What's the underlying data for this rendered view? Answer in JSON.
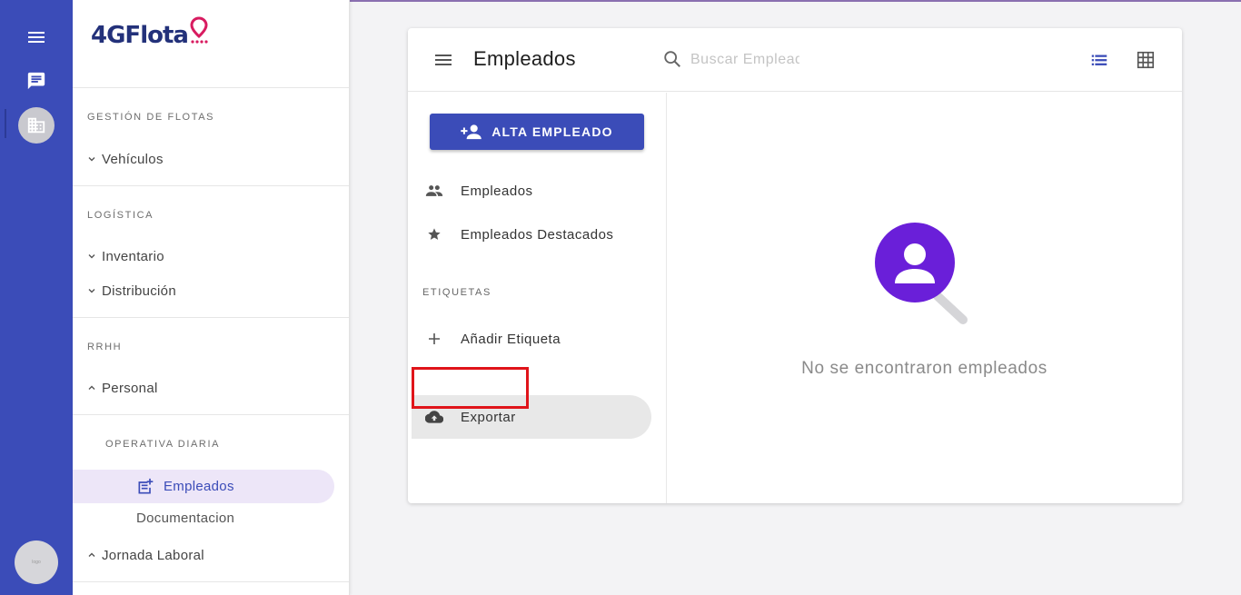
{
  "app": {
    "logo": "4GFlota"
  },
  "rail": {
    "menu_icon": "hamburger-icon",
    "chat_icon": "chat-icon",
    "company_icon": "building-icon",
    "avatar_text": "logo"
  },
  "nav": {
    "sections": [
      {
        "label": "GESTIÓN DE FLOTAS",
        "items": [
          {
            "label": "Vehículos",
            "expanded": false
          }
        ]
      },
      {
        "label": "LOGÍSTICA",
        "items": [
          {
            "label": "Inventario",
            "expanded": false
          },
          {
            "label": "Distribución",
            "expanded": false
          }
        ]
      },
      {
        "label": "RRHH",
        "items": [
          {
            "label": "Personal",
            "expanded": true
          }
        ]
      }
    ],
    "subsection_label": "OPERATIVA DIARIA",
    "active_item": "Empleados",
    "sub_item": "Documentacion",
    "jornada": "Jornada Laboral"
  },
  "card": {
    "title": "Empleados",
    "search_placeholder": "Buscar Empleado",
    "new_button": "ALTA EMPLEADO",
    "menu": [
      {
        "label": "Empleados",
        "icon": "people-icon"
      },
      {
        "label": "Empleados Destacados",
        "icon": "star-icon"
      }
    ],
    "labels_title": "ETIQUETAS",
    "add_label": "Añadir Etiqueta",
    "export": "Exportar",
    "empty_message": "No se encontraron empleados"
  },
  "colors": {
    "primary": "#3b4cb8",
    "brand_pink": "#d81b60",
    "highlight": "#e0141a",
    "empty_purple": "#6a1fd9"
  }
}
